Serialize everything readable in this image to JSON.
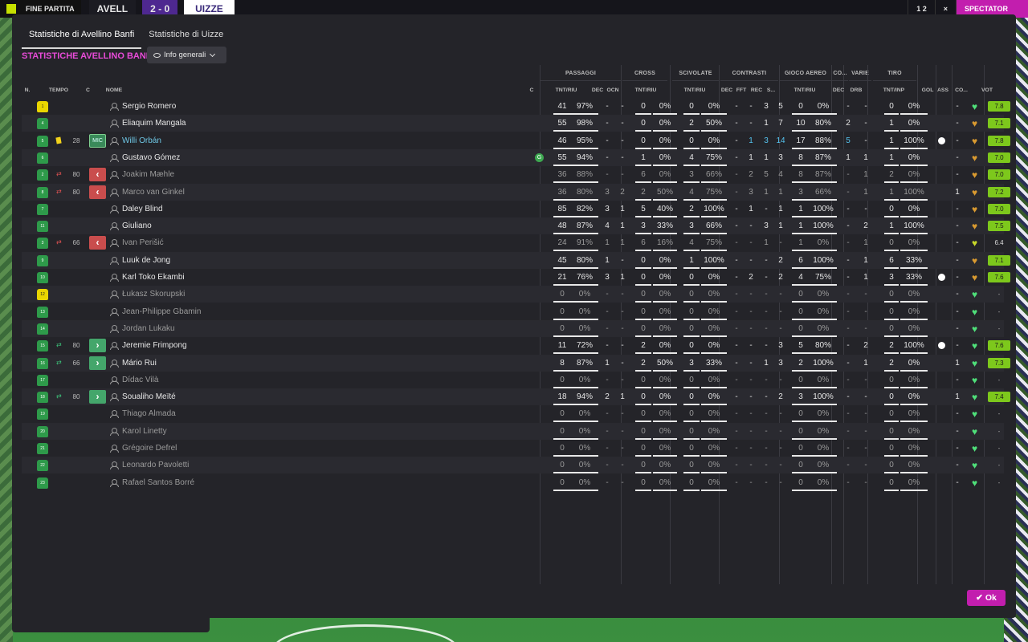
{
  "topbar": {
    "left_label": "FINE PARTITA",
    "team_a": "AVELL",
    "score": "2 - 0",
    "team_b": "UIZZE",
    "right_score": "1 2",
    "close": "×",
    "spectator_btn": "SPECTATOR"
  },
  "tabs": [
    "Statistiche di Avellino Banfi",
    "Statistiche di Uizze"
  ],
  "section_title": "STATISTICHE AVELLINO BANFI",
  "dropdown_label": "Info generali",
  "groups": [
    "PASSAGGI",
    "CROSS",
    "SCIVOLATE",
    "CONTRASTI",
    "GIOCO AEREO",
    "CO...",
    "VARIE",
    "TIRO"
  ],
  "col_headers": {
    "n": "N.",
    "tempo": "TEMPO",
    "c": "C",
    "nome": "NOME",
    "cap": "C",
    "pass_tr": "TNT/RIU",
    "pass_dec": "DEC",
    "pass_ocn": "OCN",
    "cross_tr": "TNT/RIU",
    "sciv_tr": "TNT/RIU",
    "con_dec": "DEC",
    "con_fft": "FFT",
    "con_rec": "REC",
    "con_s": "S...",
    "aer_tr": "TNT/RIU",
    "co_dec": "DEC",
    "var_drb": "DRB",
    "tiro_tr": "TNT/INP",
    "gol": "GOL",
    "ass": "ASS",
    "co": "CO...",
    "vot": "VOT"
  },
  "players": [
    {
      "num": "1",
      "gk": true,
      "card": "",
      "sub": "",
      "min": "",
      "pos": "",
      "name": "Sergio Romero",
      "dim": false,
      "sel": false,
      "pass": [
        "41",
        "97%"
      ],
      "pdec": "-",
      "pocn": "-",
      "cross": [
        "0",
        "0%"
      ],
      "sciv": [
        "0",
        "0%"
      ],
      "cdec": "-",
      "cfft": "-",
      "crec": "3",
      "cs": "5",
      "aer": [
        "0",
        "0%"
      ],
      "codec": "-",
      "drb": "-",
      "tiro": [
        "0",
        "0%"
      ],
      "gol": false,
      "ass": "-",
      "heart": "green",
      "vot": "7.8"
    },
    {
      "num": "4",
      "gk": false,
      "card": "",
      "sub": "",
      "min": "",
      "pos": "",
      "name": "Eliaquim Mangala",
      "dim": false,
      "sel": false,
      "pass": [
        "55",
        "98%"
      ],
      "pdec": "-",
      "pocn": "-",
      "cross": [
        "0",
        "0%"
      ],
      "sciv": [
        "2",
        "50%"
      ],
      "cdec": "-",
      "cfft": "-",
      "crec": "1",
      "cs": "7",
      "aer": [
        "10",
        "80%"
      ],
      "codec": "2",
      "drb": "-",
      "tiro": [
        "1",
        "0%"
      ],
      "gol": false,
      "ass": "-",
      "heart": "orange",
      "vot": "7.1"
    },
    {
      "num": "5",
      "gk": false,
      "card": "yellow",
      "sub": "",
      "min": "28",
      "pos": "MIC",
      "name": "Willi Orbán",
      "dim": false,
      "sel": true,
      "pass": [
        "46",
        "95%"
      ],
      "pdec": "-",
      "pocn": "-",
      "cross": [
        "0",
        "0%"
      ],
      "sciv": [
        "0",
        "0%"
      ],
      "cdec": "-",
      "cfft": "1",
      "crec": "3",
      "cs": "14",
      "aer": [
        "17",
        "88%"
      ],
      "codec": "5",
      "drb": "-",
      "tiro": [
        "1",
        "100%"
      ],
      "gol": true,
      "ass": "-",
      "heart": "orange",
      "vot": "7.8"
    },
    {
      "num": "6",
      "gk": false,
      "card": "",
      "sub": "",
      "min": "",
      "pos": "",
      "name": "Gustavo Gómez",
      "dim": false,
      "sel": false,
      "goal": true,
      "pass": [
        "55",
        "94%"
      ],
      "pdec": "-",
      "pocn": "-",
      "cross": [
        "1",
        "0%"
      ],
      "sciv": [
        "4",
        "75%"
      ],
      "cdec": "-",
      "cfft": "1",
      "crec": "1",
      "cs": "3",
      "aer": [
        "8",
        "87%"
      ],
      "codec": "1",
      "drb": "1",
      "tiro": [
        "1",
        "0%"
      ],
      "gol": false,
      "ass": "-",
      "heart": "orange",
      "vot": "7.0"
    },
    {
      "num": "2",
      "gk": false,
      "card": "",
      "sub": "off",
      "min": "80",
      "pos": "out",
      "name": "Joakim Mæhle",
      "dim": true,
      "sel": false,
      "pass": [
        "36",
        "88%"
      ],
      "pdec": "-",
      "pocn": "-",
      "cross": [
        "6",
        "0%"
      ],
      "sciv": [
        "3",
        "66%"
      ],
      "cdec": "-",
      "cfft": "2",
      "crec": "5",
      "cs": "4",
      "aer": [
        "8",
        "87%"
      ],
      "codec": "-",
      "drb": "1",
      "tiro": [
        "2",
        "0%"
      ],
      "gol": false,
      "ass": "-",
      "heart": "orange",
      "vot": "7.0"
    },
    {
      "num": "8",
      "gk": false,
      "card": "",
      "sub": "off",
      "min": "80",
      "pos": "out",
      "name": "Marco van Ginkel",
      "dim": true,
      "sel": false,
      "pass": [
        "36",
        "80%"
      ],
      "pdec": "3",
      "pocn": "2",
      "cross": [
        "2",
        "50%"
      ],
      "sciv": [
        "4",
        "75%"
      ],
      "cdec": "-",
      "cfft": "3",
      "crec": "1",
      "cs": "1",
      "aer": [
        "3",
        "66%"
      ],
      "codec": "-",
      "drb": "1",
      "tiro": [
        "1",
        "100%"
      ],
      "gol": false,
      "ass": "1",
      "heart": "orange",
      "vot": "7.2"
    },
    {
      "num": "7",
      "gk": false,
      "card": "",
      "sub": "",
      "min": "",
      "pos": "",
      "name": "Daley Blind",
      "dim": false,
      "sel": false,
      "pass": [
        "85",
        "82%"
      ],
      "pdec": "3",
      "pocn": "1",
      "cross": [
        "5",
        "40%"
      ],
      "sciv": [
        "2",
        "100%"
      ],
      "cdec": "-",
      "cfft": "1",
      "crec": "-",
      "cs": "1",
      "aer": [
        "1",
        "100%"
      ],
      "codec": "-",
      "drb": "-",
      "tiro": [
        "0",
        "0%"
      ],
      "gol": false,
      "ass": "-",
      "heart": "orange",
      "vot": "7.0"
    },
    {
      "num": "11",
      "gk": false,
      "card": "",
      "sub": "",
      "min": "",
      "pos": "",
      "name": "Giuliano",
      "dim": false,
      "sel": false,
      "pass": [
        "48",
        "87%"
      ],
      "pdec": "4",
      "pocn": "1",
      "cross": [
        "3",
        "33%"
      ],
      "sciv": [
        "3",
        "66%"
      ],
      "cdec": "-",
      "cfft": "-",
      "crec": "3",
      "cs": "1",
      "aer": [
        "1",
        "100%"
      ],
      "codec": "-",
      "drb": "2",
      "tiro": [
        "1",
        "100%"
      ],
      "gol": false,
      "ass": "-",
      "heart": "orange",
      "vot": "7.5"
    },
    {
      "num": "3",
      "gk": false,
      "card": "",
      "sub": "off",
      "min": "66",
      "pos": "out",
      "name": "Ivan Perišić",
      "dim": true,
      "sel": false,
      "pass": [
        "24",
        "91%"
      ],
      "pdec": "1",
      "pocn": "1",
      "cross": [
        "6",
        "16%"
      ],
      "sciv": [
        "4",
        "75%"
      ],
      "cdec": "-",
      "cfft": "-",
      "crec": "1",
      "cs": "-",
      "aer": [
        "1",
        "0%"
      ],
      "codec": "-",
      "drb": "1",
      "tiro": [
        "0",
        "0%"
      ],
      "gol": false,
      "ass": "-",
      "heart": "yellow",
      "vot": "6.4"
    },
    {
      "num": "9",
      "gk": false,
      "card": "",
      "sub": "",
      "min": "",
      "pos": "",
      "name": "Luuk de Jong",
      "dim": false,
      "sel": false,
      "pass": [
        "45",
        "80%"
      ],
      "pdec": "1",
      "pocn": "-",
      "cross": [
        "0",
        "0%"
      ],
      "sciv": [
        "1",
        "100%"
      ],
      "cdec": "-",
      "cfft": "-",
      "crec": "-",
      "cs": "2",
      "aer": [
        "6",
        "100%"
      ],
      "codec": "-",
      "drb": "1",
      "tiro": [
        "6",
        "33%"
      ],
      "gol": false,
      "ass": "-",
      "heart": "orange",
      "vot": "7.1"
    },
    {
      "num": "10",
      "gk": false,
      "card": "",
      "sub": "",
      "min": "",
      "pos": "",
      "name": "Karl Toko Ekambi",
      "dim": false,
      "sel": false,
      "pass": [
        "21",
        "76%"
      ],
      "pdec": "3",
      "pocn": "1",
      "cross": [
        "0",
        "0%"
      ],
      "sciv": [
        "0",
        "0%"
      ],
      "cdec": "-",
      "cfft": "2",
      "crec": "-",
      "cs": "2",
      "aer": [
        "4",
        "75%"
      ],
      "codec": "-",
      "drb": "1",
      "tiro": [
        "3",
        "33%"
      ],
      "gol": true,
      "ass": "-",
      "heart": "orange",
      "vot": "7.6"
    },
    {
      "num": "12",
      "gk": true,
      "card": "",
      "sub": "",
      "min": "",
      "pos": "",
      "name": "Łukasz Skorupski",
      "dim": true,
      "sel": false,
      "pass": [
        "0",
        "0%"
      ],
      "pdec": "-",
      "pocn": "-",
      "cross": [
        "0",
        "0%"
      ],
      "sciv": [
        "0",
        "0%"
      ],
      "cdec": "-",
      "cfft": "-",
      "crec": "-",
      "cs": "-",
      "aer": [
        "0",
        "0%"
      ],
      "codec": "-",
      "drb": "-",
      "tiro": [
        "0",
        "0%"
      ],
      "gol": false,
      "ass": "-",
      "heart": "green",
      "vot": "-"
    },
    {
      "num": "13",
      "gk": false,
      "card": "",
      "sub": "",
      "min": "",
      "pos": "",
      "name": "Jean-Philippe Gbamin",
      "dim": true,
      "sel": false,
      "pass": [
        "0",
        "0%"
      ],
      "pdec": "-",
      "pocn": "-",
      "cross": [
        "0",
        "0%"
      ],
      "sciv": [
        "0",
        "0%"
      ],
      "cdec": "-",
      "cfft": "-",
      "crec": "-",
      "cs": "-",
      "aer": [
        "0",
        "0%"
      ],
      "codec": "-",
      "drb": "-",
      "tiro": [
        "0",
        "0%"
      ],
      "gol": false,
      "ass": "-",
      "heart": "green",
      "vot": "-"
    },
    {
      "num": "14",
      "gk": false,
      "card": "",
      "sub": "",
      "min": "",
      "pos": "",
      "name": "Jordan Lukaku",
      "dim": true,
      "sel": false,
      "pass": [
        "0",
        "0%"
      ],
      "pdec": "-",
      "pocn": "-",
      "cross": [
        "0",
        "0%"
      ],
      "sciv": [
        "0",
        "0%"
      ],
      "cdec": "-",
      "cfft": "-",
      "crec": "-",
      "cs": "-",
      "aer": [
        "0",
        "0%"
      ],
      "codec": "-",
      "drb": "-",
      "tiro": [
        "0",
        "0%"
      ],
      "gol": false,
      "ass": "-",
      "heart": "green",
      "vot": "-"
    },
    {
      "num": "15",
      "gk": false,
      "card": "",
      "sub": "on",
      "min": "80",
      "pos": "in",
      "name": "Jeremie Frimpong",
      "dim": false,
      "sel": false,
      "pass": [
        "11",
        "72%"
      ],
      "pdec": "-",
      "pocn": "-",
      "cross": [
        "2",
        "0%"
      ],
      "sciv": [
        "0",
        "0%"
      ],
      "cdec": "-",
      "cfft": "-",
      "crec": "-",
      "cs": "3",
      "aer": [
        "5",
        "80%"
      ],
      "codec": "-",
      "drb": "2",
      "tiro": [
        "2",
        "100%"
      ],
      "gol": true,
      "ass": "-",
      "heart": "green",
      "vot": "7.6"
    },
    {
      "num": "16",
      "gk": false,
      "card": "",
      "sub": "on",
      "min": "66",
      "pos": "in",
      "name": "Mário Rui",
      "dim": false,
      "sel": false,
      "pass": [
        "8",
        "87%"
      ],
      "pdec": "1",
      "pocn": "-",
      "cross": [
        "2",
        "50%"
      ],
      "sciv": [
        "3",
        "33%"
      ],
      "cdec": "-",
      "cfft": "-",
      "crec": "1",
      "cs": "3",
      "aer": [
        "2",
        "100%"
      ],
      "codec": "-",
      "drb": "1",
      "tiro": [
        "2",
        "0%"
      ],
      "gol": false,
      "ass": "1",
      "heart": "green",
      "vot": "7.3"
    },
    {
      "num": "17",
      "gk": false,
      "card": "",
      "sub": "",
      "min": "",
      "pos": "",
      "name": "Dídac Vilà",
      "dim": true,
      "sel": false,
      "pass": [
        "0",
        "0%"
      ],
      "pdec": "-",
      "pocn": "-",
      "cross": [
        "0",
        "0%"
      ],
      "sciv": [
        "0",
        "0%"
      ],
      "cdec": "-",
      "cfft": "-",
      "crec": "-",
      "cs": "-",
      "aer": [
        "0",
        "0%"
      ],
      "codec": "-",
      "drb": "-",
      "tiro": [
        "0",
        "0%"
      ],
      "gol": false,
      "ass": "-",
      "heart": "green",
      "vot": "-"
    },
    {
      "num": "18",
      "gk": false,
      "card": "",
      "sub": "on",
      "min": "80",
      "pos": "in",
      "name": "Soualiho Meïté",
      "dim": false,
      "sel": false,
      "pass": [
        "18",
        "94%"
      ],
      "pdec": "2",
      "pocn": "1",
      "cross": [
        "0",
        "0%"
      ],
      "sciv": [
        "0",
        "0%"
      ],
      "cdec": "-",
      "cfft": "-",
      "crec": "-",
      "cs": "2",
      "aer": [
        "3",
        "100%"
      ],
      "codec": "-",
      "drb": "-",
      "tiro": [
        "0",
        "0%"
      ],
      "gol": false,
      "ass": "1",
      "heart": "green",
      "vot": "7.4"
    },
    {
      "num": "19",
      "gk": false,
      "card": "",
      "sub": "",
      "min": "",
      "pos": "",
      "name": "Thiago Almada",
      "dim": true,
      "sel": false,
      "pass": [
        "0",
        "0%"
      ],
      "pdec": "-",
      "pocn": "-",
      "cross": [
        "0",
        "0%"
      ],
      "sciv": [
        "0",
        "0%"
      ],
      "cdec": "-",
      "cfft": "-",
      "crec": "-",
      "cs": "-",
      "aer": [
        "0",
        "0%"
      ],
      "codec": "-",
      "drb": "-",
      "tiro": [
        "0",
        "0%"
      ],
      "gol": false,
      "ass": "-",
      "heart": "green",
      "vot": "-"
    },
    {
      "num": "20",
      "gk": false,
      "card": "",
      "sub": "",
      "min": "",
      "pos": "",
      "name": "Karol Linetty",
      "dim": true,
      "sel": false,
      "pass": [
        "0",
        "0%"
      ],
      "pdec": "-",
      "pocn": "-",
      "cross": [
        "0",
        "0%"
      ],
      "sciv": [
        "0",
        "0%"
      ],
      "cdec": "-",
      "cfft": "-",
      "crec": "-",
      "cs": "-",
      "aer": [
        "0",
        "0%"
      ],
      "codec": "-",
      "drb": "-",
      "tiro": [
        "0",
        "0%"
      ],
      "gol": false,
      "ass": "-",
      "heart": "green",
      "vot": "-"
    },
    {
      "num": "21",
      "gk": false,
      "card": "",
      "sub": "",
      "min": "",
      "pos": "",
      "name": "Grégoire Defrel",
      "dim": true,
      "sel": false,
      "pass": [
        "0",
        "0%"
      ],
      "pdec": "-",
      "pocn": "-",
      "cross": [
        "0",
        "0%"
      ],
      "sciv": [
        "0",
        "0%"
      ],
      "cdec": "-",
      "cfft": "-",
      "crec": "-",
      "cs": "-",
      "aer": [
        "0",
        "0%"
      ],
      "codec": "-",
      "drb": "-",
      "tiro": [
        "0",
        "0%"
      ],
      "gol": false,
      "ass": "-",
      "heart": "green",
      "vot": "-"
    },
    {
      "num": "22",
      "gk": false,
      "card": "",
      "sub": "",
      "min": "",
      "pos": "",
      "name": "Leonardo Pavoletti",
      "dim": true,
      "sel": false,
      "pass": [
        "0",
        "0%"
      ],
      "pdec": "-",
      "pocn": "-",
      "cross": [
        "0",
        "0%"
      ],
      "sciv": [
        "0",
        "0%"
      ],
      "cdec": "-",
      "cfft": "-",
      "crec": "-",
      "cs": "-",
      "aer": [
        "0",
        "0%"
      ],
      "codec": "-",
      "drb": "-",
      "tiro": [
        "0",
        "0%"
      ],
      "gol": false,
      "ass": "-",
      "heart": "green",
      "vot": "-"
    },
    {
      "num": "23",
      "gk": false,
      "card": "",
      "sub": "",
      "min": "",
      "pos": "",
      "name": "Rafael Santos Borré",
      "dim": true,
      "sel": false,
      "pass": [
        "0",
        "0%"
      ],
      "pdec": "-",
      "pocn": "-",
      "cross": [
        "0",
        "0%"
      ],
      "sciv": [
        "0",
        "0%"
      ],
      "cdec": "-",
      "cfft": "-",
      "crec": "-",
      "cs": "-",
      "aer": [
        "0",
        "0%"
      ],
      "codec": "-",
      "drb": "-",
      "tiro": [
        "0",
        "0%"
      ],
      "gol": false,
      "ass": "-",
      "heart": "green",
      "vot": "-"
    }
  ],
  "ok_label": "Ok",
  "colors": {
    "accent": "#c21eae",
    "title": "#e84bd8",
    "rating": "#7dc81c",
    "sub_out": "#c94d4d",
    "sub_in": "#44a66b"
  }
}
